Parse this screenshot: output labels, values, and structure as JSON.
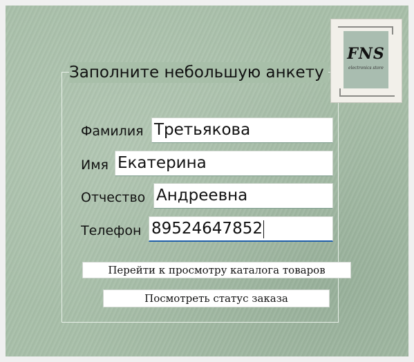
{
  "form": {
    "title": "Заполните небольшую анкету",
    "fields": [
      {
        "label": "Фамилия",
        "value": "Третьякова"
      },
      {
        "label": "Имя",
        "value": "Екатерина"
      },
      {
        "label": "Отчество",
        "value": "Андреевна"
      },
      {
        "label": "Телефон",
        "value": "89524647852"
      }
    ]
  },
  "logo": {
    "text": "FNS",
    "subtitle": "electronics store"
  },
  "buttons": {
    "catalog": "Перейти к просмотру каталога товаров",
    "order_status": "Посмотреть статус заказа"
  },
  "colors": {
    "background": "#a8bfa9",
    "focus_underline": "#1f5ea8"
  }
}
